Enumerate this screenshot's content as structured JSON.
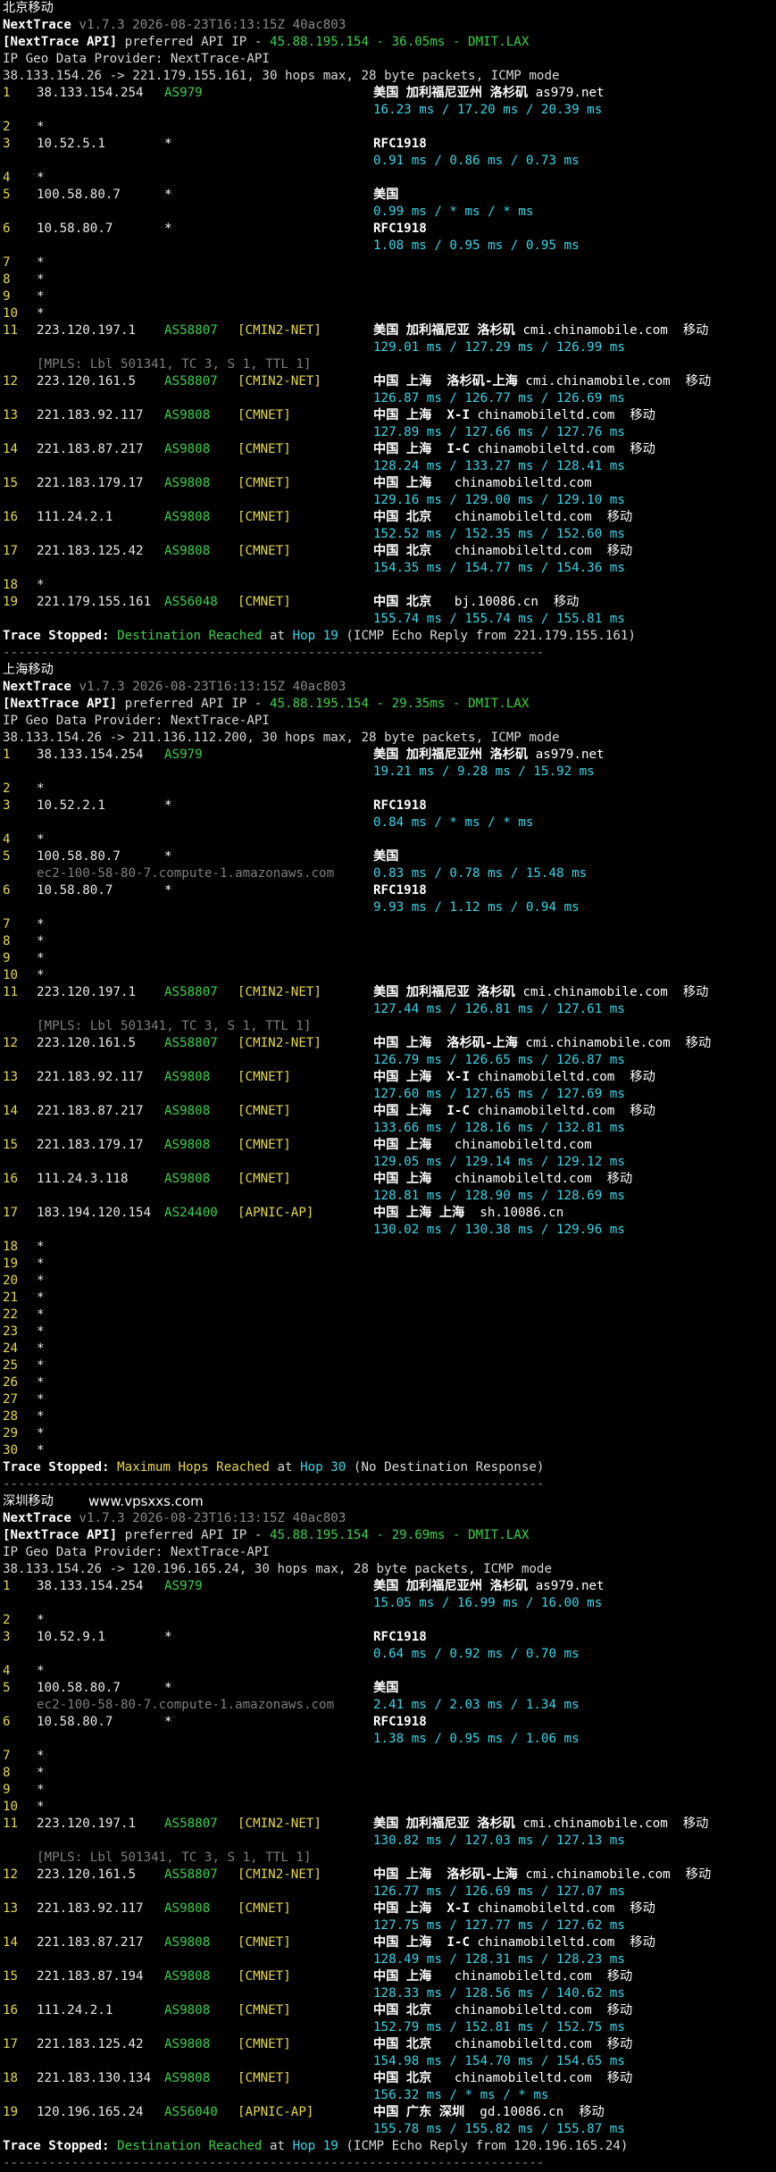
{
  "colors": {
    "background": "#000000",
    "hop": "#e6d84a",
    "asn": "#3ad14a",
    "tag": "#e6d84a",
    "latency": "#38d6e8",
    "muted": "#8a8a8a",
    "text": "#d8d8d8"
  },
  "watermark": "www.vpsxxs.com",
  "sections": [
    {
      "title": "北京移动",
      "tool": "NextTrace",
      "version": "v1.7.3 2026-08-23T16:13:15Z 40ac803",
      "api_prefix": "[NextTrace API]",
      "api_mid": " preferred API IP - ",
      "api_val": "45.88.195.154 - 36.05ms - DMIT.LAX",
      "geo_provider": "IP Geo Data Provider: NextTrace-API",
      "route": "38.133.154.26 -> 221.179.155.161, 30 hops max, 28 byte packets, ICMP mode",
      "hops": [
        {
          "n": "1",
          "ip": "38.133.154.254",
          "as": "AS979",
          "tag": "",
          "geo": "美国 加利福尼亚州 洛杉矶",
          "host": "as979.net",
          "lat": "16.23 ms / 17.20 ms / 20.39 ms"
        },
        {
          "n": "2",
          "ip": "*"
        },
        {
          "n": "3",
          "ip": "10.52.5.1",
          "as": "*",
          "tag": "",
          "geo": "RFC1918",
          "host": "",
          "lat": "0.91 ms / 0.86 ms / 0.73 ms"
        },
        {
          "n": "4",
          "ip": "*"
        },
        {
          "n": "5",
          "ip": "100.58.80.7",
          "as": "*",
          "tag": "",
          "geo": "美国",
          "host": "",
          "lat": "0.99 ms / * ms / * ms"
        },
        {
          "n": "6",
          "ip": "10.58.80.7",
          "as": "*",
          "tag": "",
          "geo": "RFC1918",
          "host": "",
          "lat": "1.08 ms / 0.95 ms / 0.95 ms"
        },
        {
          "n": "7",
          "ip": "*"
        },
        {
          "n": "8",
          "ip": "*"
        },
        {
          "n": "9",
          "ip": "*"
        },
        {
          "n": "10",
          "ip": "*"
        },
        {
          "n": "11",
          "ip": "223.120.197.1",
          "as": "AS58807",
          "tag": "[CMIN2-NET]",
          "geo": "美国 加利福尼亚 洛杉矶",
          "host": "cmi.chinamobile.com  移动",
          "lat": "129.01 ms / 127.29 ms / 126.99 ms",
          "note": "[MPLS: Lbl 501341, TC 3, S 1, TTL 1]"
        },
        {
          "n": "12",
          "ip": "223.120.161.5",
          "as": "AS58807",
          "tag": "[CMIN2-NET]",
          "geo": "中国 上海  洛杉矶-上海",
          "host": "cmi.chinamobile.com  移动",
          "lat": "126.87 ms / 126.77 ms / 126.69 ms"
        },
        {
          "n": "13",
          "ip": "221.183.92.117",
          "as": "AS9808",
          "tag": "[CMNET]",
          "geo": "中国 上海  X-I",
          "host": "chinamobileltd.com  移动",
          "lat": "127.89 ms / 127.66 ms / 127.76 ms"
        },
        {
          "n": "14",
          "ip": "221.183.87.217",
          "as": "AS9808",
          "tag": "[CMNET]",
          "geo": "中国 上海  I-C",
          "host": "chinamobileltd.com  移动",
          "lat": "128.24 ms / 133.27 ms / 128.41 ms"
        },
        {
          "n": "15",
          "ip": "221.183.179.17",
          "as": "AS9808",
          "tag": "[CMNET]",
          "geo": "中国 上海",
          "host": "  chinamobileltd.com",
          "lat": "129.16 ms / 129.00 ms / 129.10 ms"
        },
        {
          "n": "16",
          "ip": "111.24.2.1",
          "as": "AS9808",
          "tag": "[CMNET]",
          "geo": "中国 北京",
          "host": "  chinamobileltd.com  移动",
          "lat": "152.52 ms / 152.35 ms / 152.60 ms"
        },
        {
          "n": "17",
          "ip": "221.183.125.42",
          "as": "AS9808",
          "tag": "[CMNET]",
          "geo": "中国 北京",
          "host": "  chinamobileltd.com  移动",
          "lat": "154.35 ms / 154.77 ms / 154.36 ms"
        },
        {
          "n": "18",
          "ip": "*"
        },
        {
          "n": "19",
          "ip": "221.179.155.161",
          "as": "AS56048",
          "tag": "[CMNET]",
          "geo": "中国 北京",
          "host": "  bj.10086.cn  移动",
          "lat": "155.74 ms / 155.74 ms / 155.81 ms"
        }
      ],
      "stop_prefix": "Trace Stopped: ",
      "stop_status": "Destination Reached",
      "stop_at": " at ",
      "stop_hop": "Hop 19",
      "stop_detail": " (ICMP Echo Reply from 221.179.155.161)",
      "separator": "-----------------------------------------------------------------------"
    },
    {
      "title": "上海移动",
      "tool": "NextTrace",
      "version": "v1.7.3 2026-08-23T16:13:15Z 40ac803",
      "api_prefix": "[NextTrace API]",
      "api_mid": " preferred API IP - ",
      "api_val": "45.88.195.154 - 29.35ms - DMIT.LAX",
      "geo_provider": "IP Geo Data Provider: NextTrace-API",
      "route": "38.133.154.26 -> 211.136.112.200, 30 hops max, 28 byte packets, ICMP mode",
      "hops": [
        {
          "n": "1",
          "ip": "38.133.154.254",
          "as": "AS979",
          "tag": "",
          "geo": "美国 加利福尼亚州 洛杉矶",
          "host": "as979.net",
          "lat": "19.21 ms / 9.28 ms / 15.92 ms"
        },
        {
          "n": "2",
          "ip": "*"
        },
        {
          "n": "3",
          "ip": "10.52.2.1",
          "as": "*",
          "tag": "",
          "geo": "RFC1918",
          "host": "",
          "lat": "0.84 ms / * ms / * ms"
        },
        {
          "n": "4",
          "ip": "*"
        },
        {
          "n": "5",
          "ip": "100.58.80.7",
          "as": "*",
          "tag": "",
          "geo": "美国",
          "host": "",
          "lat": "0.83 ms / 0.78 ms / 15.48 ms",
          "inline_note": "ec2-100-58-80-7.compute-1.amazonaws.com"
        },
        {
          "n": "6",
          "ip": "10.58.80.7",
          "as": "*",
          "tag": "",
          "geo": "RFC1918",
          "host": "",
          "lat": "9.93 ms / 1.12 ms / 0.94 ms"
        },
        {
          "n": "7",
          "ip": "*"
        },
        {
          "n": "8",
          "ip": "*"
        },
        {
          "n": "9",
          "ip": "*"
        },
        {
          "n": "10",
          "ip": "*"
        },
        {
          "n": "11",
          "ip": "223.120.197.1",
          "as": "AS58807",
          "tag": "[CMIN2-NET]",
          "geo": "美国 加利福尼亚 洛杉矶",
          "host": "cmi.chinamobile.com  移动",
          "lat": "127.44 ms / 126.81 ms / 127.61 ms",
          "note": "[MPLS: Lbl 501341, TC 3, S 1, TTL 1]"
        },
        {
          "n": "12",
          "ip": "223.120.161.5",
          "as": "AS58807",
          "tag": "[CMIN2-NET]",
          "geo": "中国 上海  洛杉矶-上海",
          "host": "cmi.chinamobile.com  移动",
          "lat": "126.79 ms / 126.65 ms / 126.87 ms"
        },
        {
          "n": "13",
          "ip": "221.183.92.117",
          "as": "AS9808",
          "tag": "[CMNET]",
          "geo": "中国 上海  X-I",
          "host": "chinamobileltd.com  移动",
          "lat": "127.60 ms / 127.65 ms / 127.69 ms"
        },
        {
          "n": "14",
          "ip": "221.183.87.217",
          "as": "AS9808",
          "tag": "[CMNET]",
          "geo": "中国 上海  I-C",
          "host": "chinamobileltd.com  移动",
          "lat": "133.66 ms / 128.16 ms / 132.81 ms"
        },
        {
          "n": "15",
          "ip": "221.183.179.17",
          "as": "AS9808",
          "tag": "[CMNET]",
          "geo": "中国 上海",
          "host": "  chinamobileltd.com",
          "lat": "129.05 ms / 129.14 ms / 129.12 ms"
        },
        {
          "n": "16",
          "ip": "111.24.3.118",
          "as": "AS9808",
          "tag": "[CMNET]",
          "geo": "中国 上海",
          "host": "  chinamobileltd.com  移动",
          "lat": "128.81 ms / 128.90 ms / 128.69 ms"
        },
        {
          "n": "17",
          "ip": "183.194.120.154",
          "as": "AS24400",
          "tag": "[APNIC-AP]",
          "geo": "中国 上海 上海",
          "host": " sh.10086.cn",
          "lat": "130.02 ms / 130.38 ms / 129.96 ms"
        },
        {
          "n": "18",
          "ip": "*"
        },
        {
          "n": "19",
          "ip": "*"
        },
        {
          "n": "20",
          "ip": "*"
        },
        {
          "n": "21",
          "ip": "*"
        },
        {
          "n": "22",
          "ip": "*"
        },
        {
          "n": "23",
          "ip": "*"
        },
        {
          "n": "24",
          "ip": "*"
        },
        {
          "n": "25",
          "ip": "*"
        },
        {
          "n": "26",
          "ip": "*"
        },
        {
          "n": "27",
          "ip": "*"
        },
        {
          "n": "28",
          "ip": "*"
        },
        {
          "n": "29",
          "ip": "*"
        },
        {
          "n": "30",
          "ip": "*"
        }
      ],
      "stop_prefix": "Trace Stopped: ",
      "stop_status": "Maximum Hops Reached",
      "stop_at": " at ",
      "stop_hop": "Hop 30",
      "stop_detail": " (No Destination Response)",
      "separator": "-----------------------------------------------------------------------"
    },
    {
      "title": "深圳移动",
      "tool": "NextTrace",
      "version": "v1.7.3 2026-08-23T16:13:15Z 40ac803",
      "api_prefix": "[NextTrace API]",
      "api_mid": " preferred API IP - ",
      "api_val": "45.88.195.154 - 29.69ms - DMIT.LAX",
      "geo_provider": "IP Geo Data Provider: NextTrace-API",
      "route": "38.133.154.26 -> 120.196.165.24, 30 hops max, 28 byte packets, ICMP mode",
      "hops": [
        {
          "n": "1",
          "ip": "38.133.154.254",
          "as": "AS979",
          "tag": "",
          "geo": "美国 加利福尼亚州 洛杉矶",
          "host": "as979.net",
          "lat": "15.05 ms / 16.99 ms / 16.00 ms"
        },
        {
          "n": "2",
          "ip": "*"
        },
        {
          "n": "3",
          "ip": "10.52.9.1",
          "as": "*",
          "tag": "",
          "geo": "RFC1918",
          "host": "",
          "lat": "0.64 ms / 0.92 ms / 0.70 ms"
        },
        {
          "n": "4",
          "ip": "*"
        },
        {
          "n": "5",
          "ip": "100.58.80.7",
          "as": "*",
          "tag": "",
          "geo": "美国",
          "host": "",
          "lat": "2.41 ms / 2.03 ms / 1.34 ms",
          "inline_note": "ec2-100-58-80-7.compute-1.amazonaws.com"
        },
        {
          "n": "6",
          "ip": "10.58.80.7",
          "as": "*",
          "tag": "",
          "geo": "RFC1918",
          "host": "",
          "lat": "1.38 ms / 0.95 ms / 1.06 ms"
        },
        {
          "n": "7",
          "ip": "*"
        },
        {
          "n": "8",
          "ip": "*"
        },
        {
          "n": "9",
          "ip": "*"
        },
        {
          "n": "10",
          "ip": "*"
        },
        {
          "n": "11",
          "ip": "223.120.197.1",
          "as": "AS58807",
          "tag": "[CMIN2-NET]",
          "geo": "美国 加利福尼亚 洛杉矶",
          "host": "cmi.chinamobile.com  移动",
          "lat": "130.82 ms / 127.03 ms / 127.13 ms",
          "note": "[MPLS: Lbl 501341, TC 3, S 1, TTL 1]"
        },
        {
          "n": "12",
          "ip": "223.120.161.5",
          "as": "AS58807",
          "tag": "[CMIN2-NET]",
          "geo": "中国 上海  洛杉矶-上海",
          "host": "cmi.chinamobile.com  移动",
          "lat": "126.77 ms / 126.69 ms / 127.07 ms"
        },
        {
          "n": "13",
          "ip": "221.183.92.117",
          "as": "AS9808",
          "tag": "[CMNET]",
          "geo": "中国 上海  X-I",
          "host": "chinamobileltd.com  移动",
          "lat": "127.75 ms / 127.77 ms / 127.62 ms"
        },
        {
          "n": "14",
          "ip": "221.183.87.217",
          "as": "AS9808",
          "tag": "[CMNET]",
          "geo": "中国 上海  I-C",
          "host": "chinamobileltd.com  移动",
          "lat": "128.49 ms / 128.31 ms / 128.23 ms"
        },
        {
          "n": "15",
          "ip": "221.183.87.194",
          "as": "AS9808",
          "tag": "[CMNET]",
          "geo": "中国 上海",
          "host": "  chinamobileltd.com  移动",
          "lat": "128.33 ms / 128.56 ms / 140.62 ms"
        },
        {
          "n": "16",
          "ip": "111.24.2.1",
          "as": "AS9808",
          "tag": "[CMNET]",
          "geo": "中国 北京",
          "host": "  chinamobileltd.com  移动",
          "lat": "152.79 ms / 152.81 ms / 152.75 ms"
        },
        {
          "n": "17",
          "ip": "221.183.125.42",
          "as": "AS9808",
          "tag": "[CMNET]",
          "geo": "中国 北京",
          "host": "  chinamobileltd.com  移动",
          "lat": "154.98 ms / 154.70 ms / 154.65 ms"
        },
        {
          "n": "18",
          "ip": "221.183.130.134",
          "as": "AS9808",
          "tag": "[CMNET]",
          "geo": "中国 北京",
          "host": "  chinamobileltd.com  移动",
          "lat": "156.32 ms / * ms / * ms"
        },
        {
          "n": "19",
          "ip": "120.196.165.24",
          "as": "AS56040",
          "tag": "[APNIC-AP]",
          "geo": "中国 广东 深圳",
          "host": " gd.10086.cn  移动",
          "lat": "155.78 ms / 155.82 ms / 155.87 ms"
        }
      ],
      "stop_prefix": "Trace Stopped: ",
      "stop_status": "Destination Reached",
      "stop_at": " at ",
      "stop_hop": "Hop 19",
      "stop_detail": " (ICMP Echo Reply from 120.196.165.24)",
      "separator": "-----------------------------------------------------------------------"
    }
  ]
}
